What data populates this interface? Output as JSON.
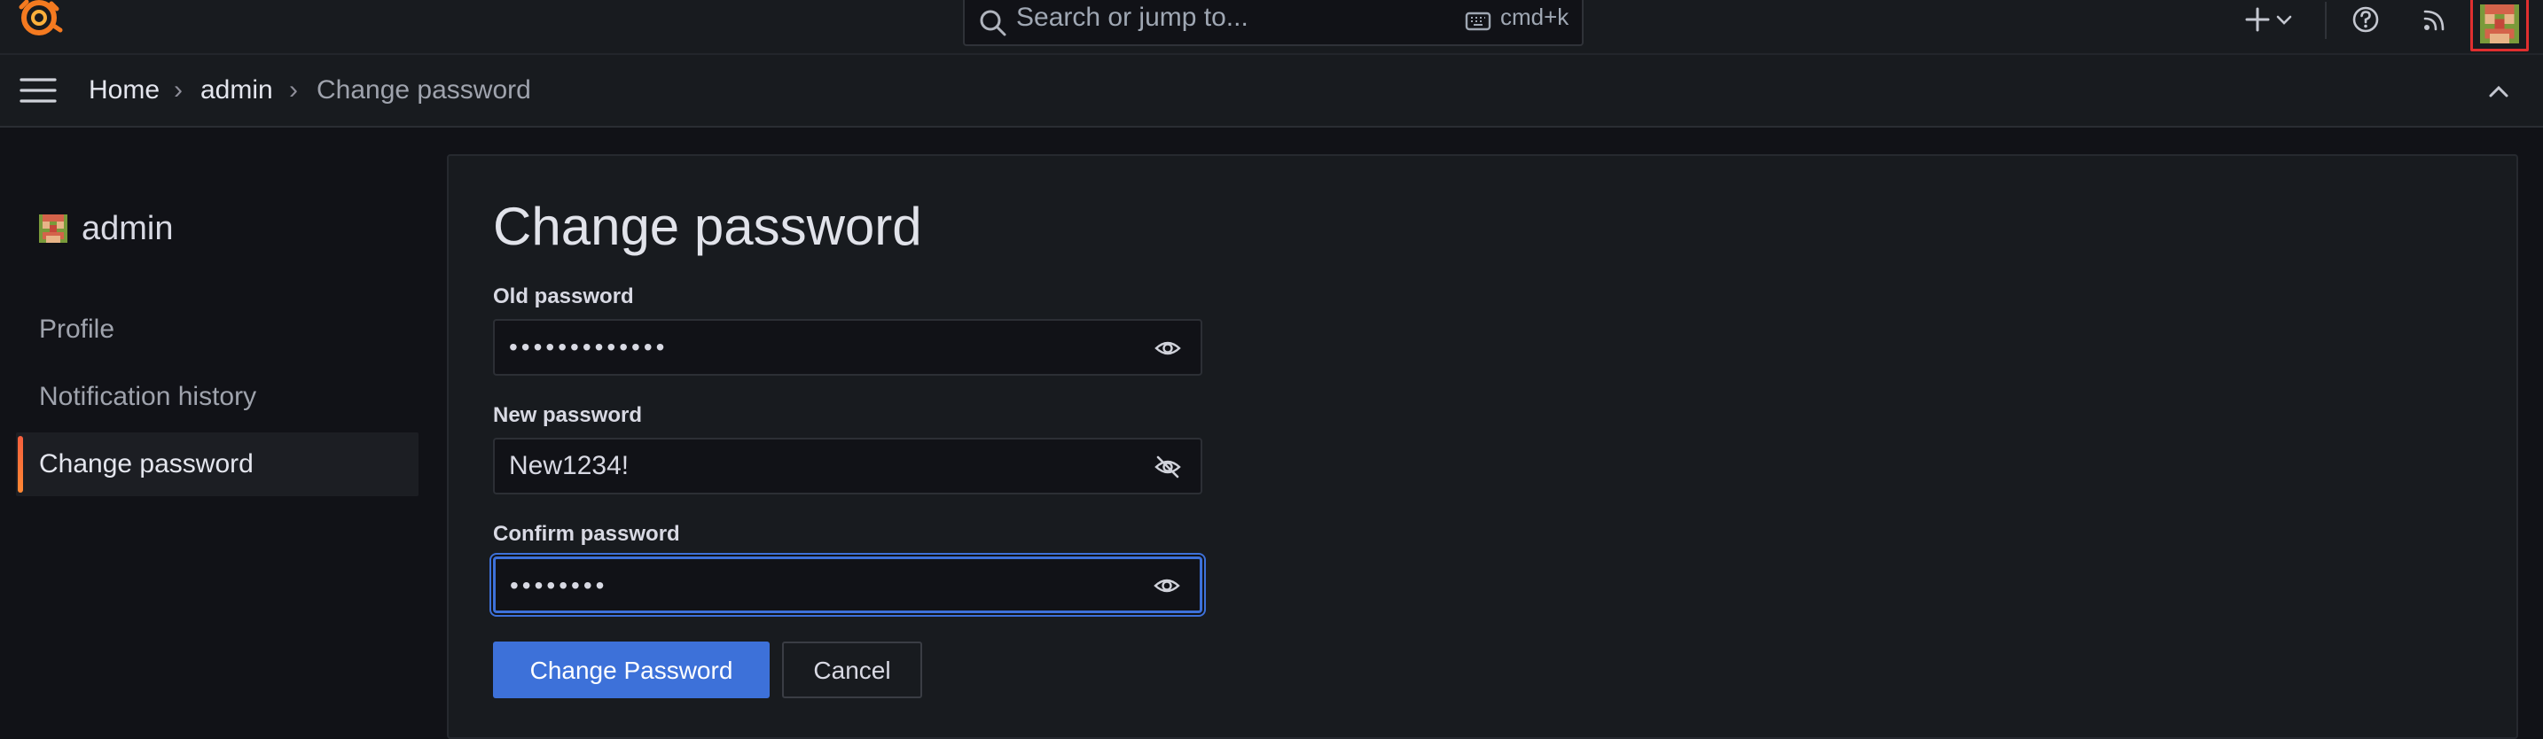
{
  "topbar": {
    "search_placeholder": "Search or jump to...",
    "shortcut": "cmd+k"
  },
  "breadcrumb": {
    "items": [
      "Home",
      "admin",
      "Change password"
    ],
    "separator": "›"
  },
  "sidebar": {
    "title": "admin",
    "items": [
      {
        "label": "Profile"
      },
      {
        "label": "Notification history"
      },
      {
        "label": "Change password",
        "active": true
      }
    ]
  },
  "form": {
    "title": "Change password",
    "old_password": {
      "label": "Old password",
      "value": "•••••••••••••"
    },
    "new_password": {
      "label": "New password",
      "value": "New1234!"
    },
    "confirm_password": {
      "label": "Confirm password",
      "value": "••••••••"
    },
    "submit_label": "Change Password",
    "cancel_label": "Cancel"
  },
  "colors": {
    "accent": "#3d71d9",
    "active_indicator": "#f55f3e",
    "highlight_box": "#e02f2f"
  }
}
